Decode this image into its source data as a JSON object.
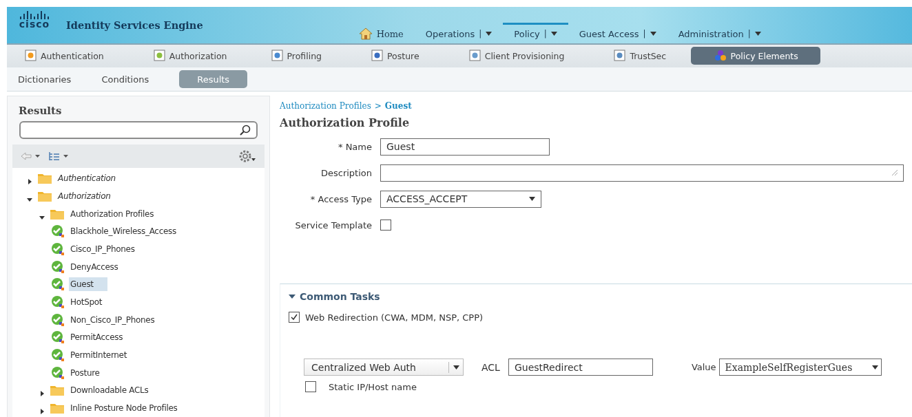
{
  "header": {
    "logo": "cisco",
    "title": "Identity Services Engine",
    "nav": [
      {
        "label": "Home",
        "kind": "home",
        "selected": false
      },
      {
        "label": "Operations",
        "kind": "menu",
        "separator": "|",
        "selected": false
      },
      {
        "label": "Policy",
        "kind": "menu",
        "separator": "|",
        "selected": true
      },
      {
        "label": "Guest Access",
        "kind": "menu",
        "separator": "|",
        "selected": false
      },
      {
        "label": "Administration",
        "kind": "menu",
        "separator": "|",
        "selected": false
      }
    ]
  },
  "tabs": [
    {
      "label": "Authentication",
      "selected": false
    },
    {
      "label": "Authorization",
      "selected": false
    },
    {
      "label": "Profiling",
      "selected": false
    },
    {
      "label": "Posture",
      "selected": false
    },
    {
      "label": "Client Provisioning",
      "selected": false
    },
    {
      "label": "TrustSec",
      "selected": false
    },
    {
      "label": "Policy Elements",
      "selected": true
    }
  ],
  "subtabs": [
    {
      "label": "Dictionaries",
      "selected": false
    },
    {
      "label": "Conditions",
      "selected": false
    },
    {
      "label": "Results",
      "selected": true
    }
  ],
  "sidebar": {
    "title": "Results",
    "tree": [
      {
        "label": "Authentication",
        "kind": "folder",
        "italic": true,
        "expanded": false
      },
      {
        "label": "Authorization",
        "kind": "folder",
        "italic": true,
        "expanded": true,
        "children": [
          {
            "label": "Authorization Profiles",
            "kind": "folder",
            "italic": false,
            "expanded": true,
            "children": [
              {
                "label": "Blackhole_Wireless_Access",
                "kind": "profile",
                "selected": false
              },
              {
                "label": "Cisco_IP_Phones",
                "kind": "profile",
                "selected": false
              },
              {
                "label": "DenyAccess",
                "kind": "profile",
                "selected": false
              },
              {
                "label": "Guest",
                "kind": "profile",
                "selected": true
              },
              {
                "label": "HotSpot",
                "kind": "profile",
                "selected": false
              },
              {
                "label": "Non_Cisco_IP_Phones",
                "kind": "profile",
                "selected": false
              },
              {
                "label": "PermitAccess",
                "kind": "profile",
                "selected": false
              },
              {
                "label": "PermitInternet",
                "kind": "profile",
                "selected": false
              },
              {
                "label": "Posture",
                "kind": "profile",
                "selected": false
              }
            ]
          },
          {
            "label": "Downloadable ACLs",
            "kind": "folder",
            "italic": false,
            "expanded": false
          },
          {
            "label": "Inline Posture Node Profiles",
            "kind": "folder",
            "italic": false,
            "expanded": false
          }
        ]
      }
    ]
  },
  "breadcrumb": {
    "parent": "Authorization Profiles",
    "separator": ">",
    "current": "Guest"
  },
  "form": {
    "title": "Authorization Profile",
    "required_mark": "*",
    "fields": [
      {
        "label": "Name",
        "required": true,
        "kind": "text",
        "value": "Guest"
      },
      {
        "label": "Description",
        "required": false,
        "kind": "textarea"
      },
      {
        "label": "Access Type",
        "required": true,
        "kind": "select",
        "value": "ACCESS_ACCEPT"
      },
      {
        "label": "Service Template",
        "required": false,
        "kind": "checkbox",
        "checked": false
      }
    ]
  },
  "common_tasks": {
    "title": "Common Tasks",
    "expanded": true,
    "web_redirection": {
      "label": "Web Redirection (CWA, MDM, NSP, CPP)",
      "checked": true
    },
    "redirect_type": "Centralized Web Auth",
    "acl_label": "ACL",
    "acl": "GuestRedirect",
    "value_label": "Value",
    "value": "ExampleSelfRegisterGues",
    "static_host": {
      "label": "Static IP/Host name",
      "checked": false
    }
  }
}
